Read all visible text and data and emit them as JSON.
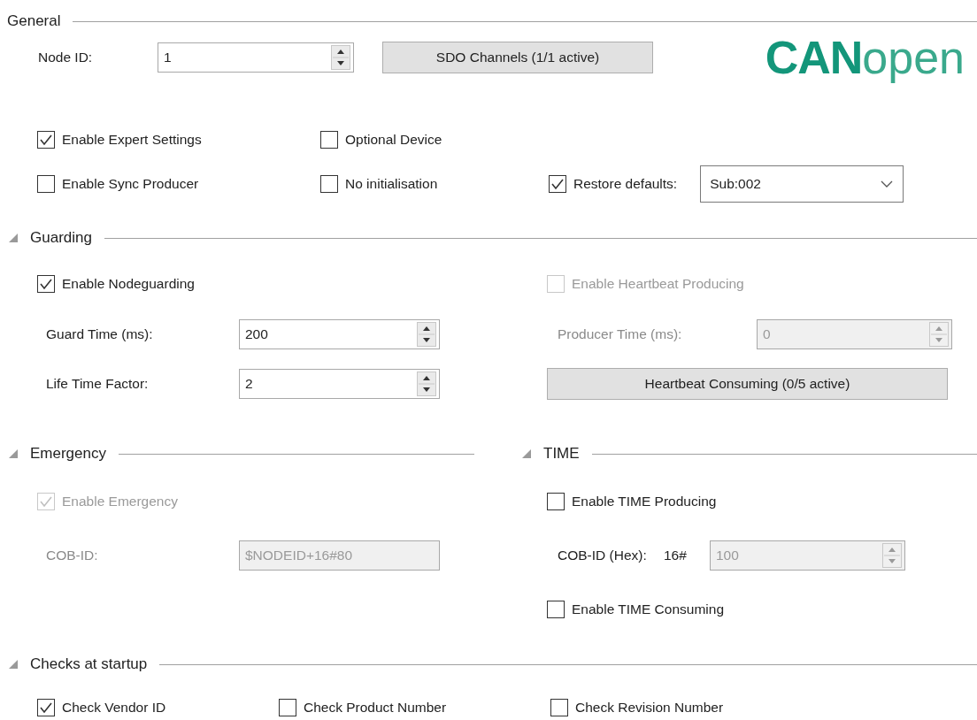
{
  "general": {
    "title": "General",
    "node_id": {
      "label": "Node ID:",
      "value": "1",
      "disabled": false
    },
    "sdo_button": {
      "label": "SDO Channels (1/1 active)"
    },
    "logo": {
      "strong": "CAN",
      "light": "open"
    },
    "options": [
      {
        "label": "Enable Expert Settings",
        "checked": true,
        "disabled": false
      },
      {
        "label": "Optional Device",
        "checked": false,
        "disabled": false
      },
      {
        "label": "Enable Sync Producer",
        "checked": false,
        "disabled": false
      },
      {
        "label": "No initialisation",
        "checked": false,
        "disabled": false
      }
    ],
    "restore_defaults": {
      "label": "Restore defaults:",
      "checked": true,
      "disabled": false,
      "value": "Sub:002"
    }
  },
  "guarding": {
    "title": "Guarding",
    "expanded": true,
    "nodeguarding": {
      "label": "Enable Nodeguarding",
      "checked": true,
      "disabled": false
    },
    "guard_time": {
      "label": "Guard Time (ms):",
      "value": "200",
      "disabled": false
    },
    "life_time_factor": {
      "label": "Life Time Factor:",
      "value": "2",
      "disabled": false
    },
    "heartbeat_producing": {
      "label": "Enable Heartbeat Producing",
      "checked": false,
      "disabled": true
    },
    "producer_time": {
      "label": "Producer Time (ms):",
      "value": "0",
      "disabled": true
    },
    "heartbeat_consuming_button": {
      "label": "Heartbeat Consuming (0/5 active)"
    }
  },
  "emergency": {
    "title": "Emergency",
    "expanded": true,
    "enable": {
      "label": "Enable Emergency",
      "checked": true,
      "disabled": true
    },
    "cob_id": {
      "label": "COB-ID:",
      "value": "$NODEID+16#80",
      "disabled": true
    }
  },
  "time": {
    "title": "TIME",
    "expanded": true,
    "producing": {
      "label": "Enable TIME Producing",
      "checked": false,
      "disabled": false
    },
    "cob_id": {
      "label": "COB-ID (Hex):",
      "prefix": "16#",
      "value": "100",
      "disabled": true
    },
    "consuming": {
      "label": "Enable TIME Consuming",
      "checked": false,
      "disabled": false
    }
  },
  "checks": {
    "title": "Checks at startup",
    "expanded": true,
    "items": [
      {
        "label": "Check Vendor ID",
        "checked": true,
        "disabled": false
      },
      {
        "label": "Check Product Number",
        "checked": false,
        "disabled": false
      },
      {
        "label": "Check Revision Number",
        "checked": false,
        "disabled": false
      }
    ]
  }
}
